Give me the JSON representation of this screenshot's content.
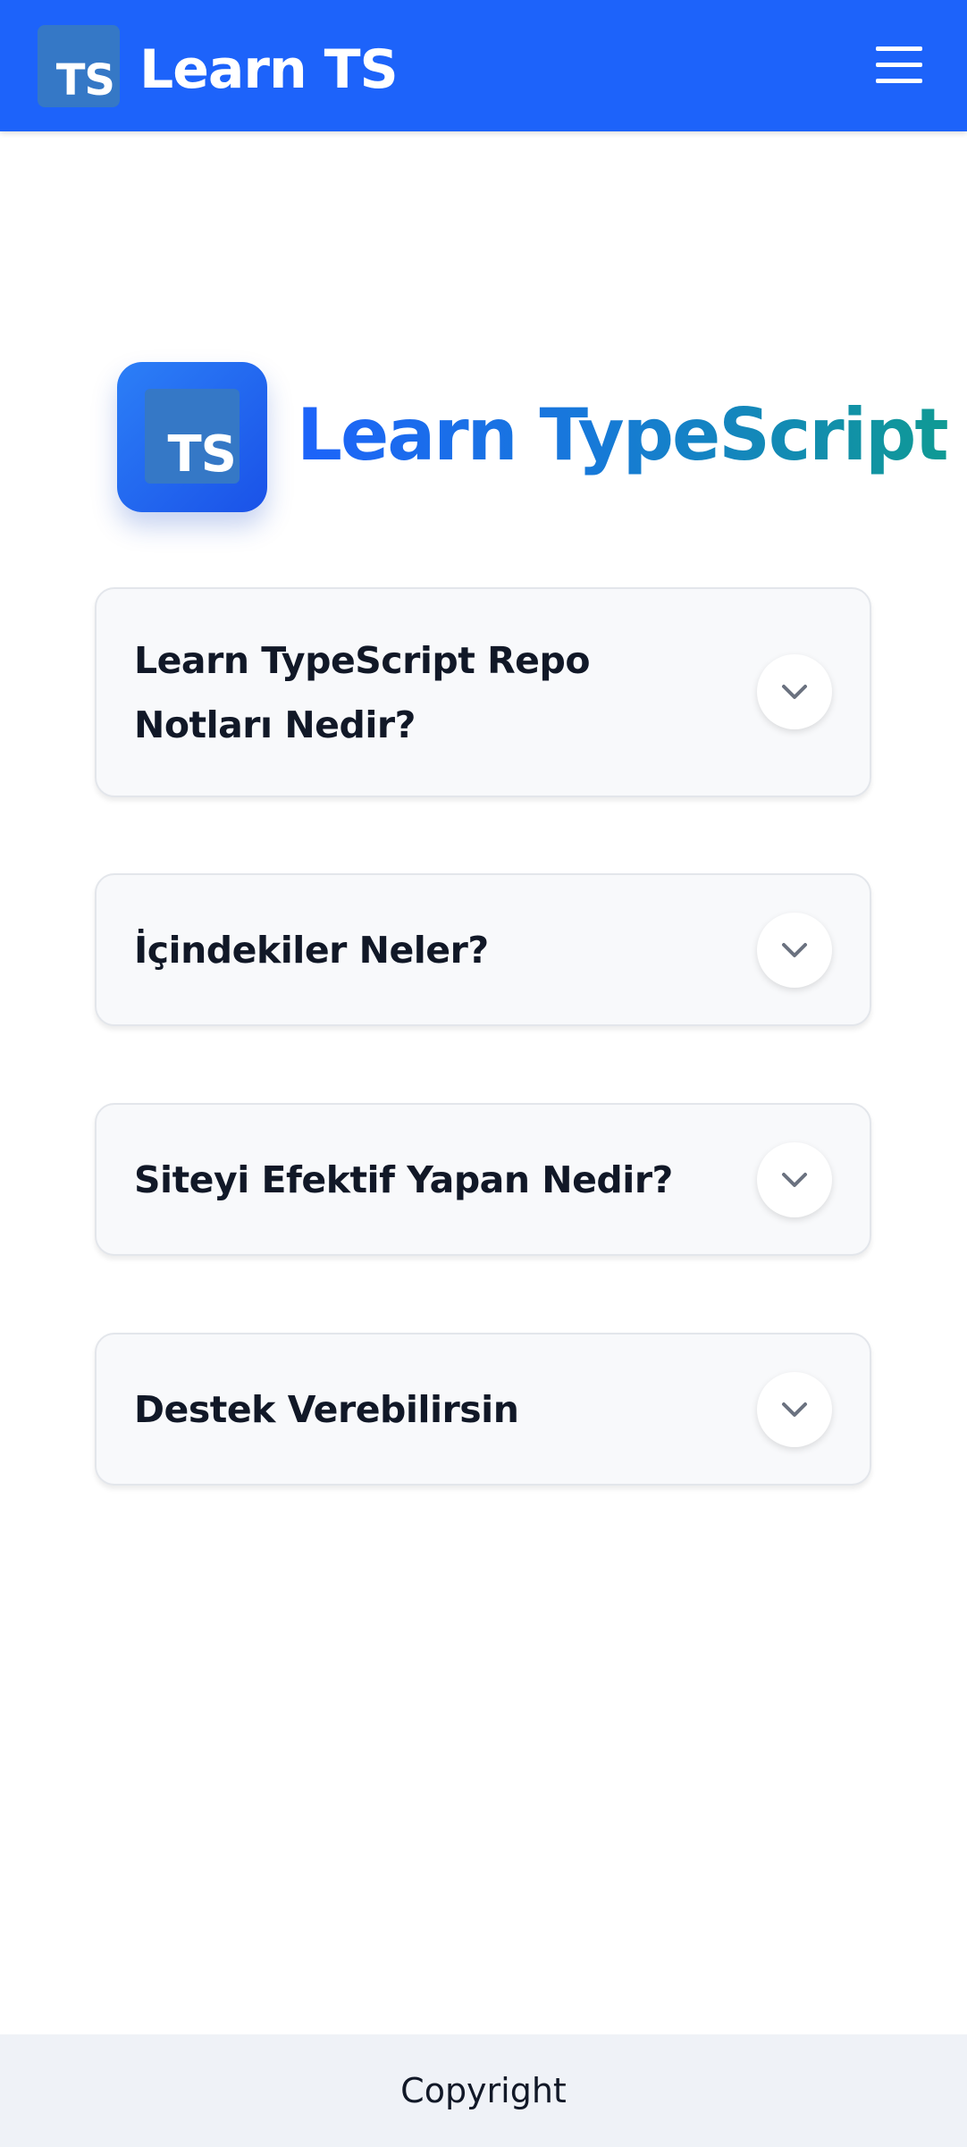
{
  "header": {
    "logo_text": "TS",
    "title": "Learn TS",
    "menu_icon": "hamburger-menu-icon",
    "background_color": "#1d63fa"
  },
  "hero": {
    "logo_text": "TS",
    "title": "Learn TypeScript",
    "gradient_colors": [
      "#1d63fa",
      "#0f9a94"
    ]
  },
  "faq": {
    "items": [
      {
        "question": "Learn TypeScript Repo Notları Nedir?",
        "expanded": false,
        "icon": "chevron-down-icon"
      },
      {
        "question": "İçindekiler Neler?",
        "expanded": false,
        "icon": "chevron-down-icon"
      },
      {
        "question": "Siteyi Efektif Yapan Nedir?",
        "expanded": false,
        "icon": "chevron-down-icon"
      },
      {
        "question": "Destek Verebilirsin",
        "expanded": false,
        "icon": "chevron-down-icon"
      }
    ]
  },
  "footer": {
    "text": "Copyright"
  }
}
